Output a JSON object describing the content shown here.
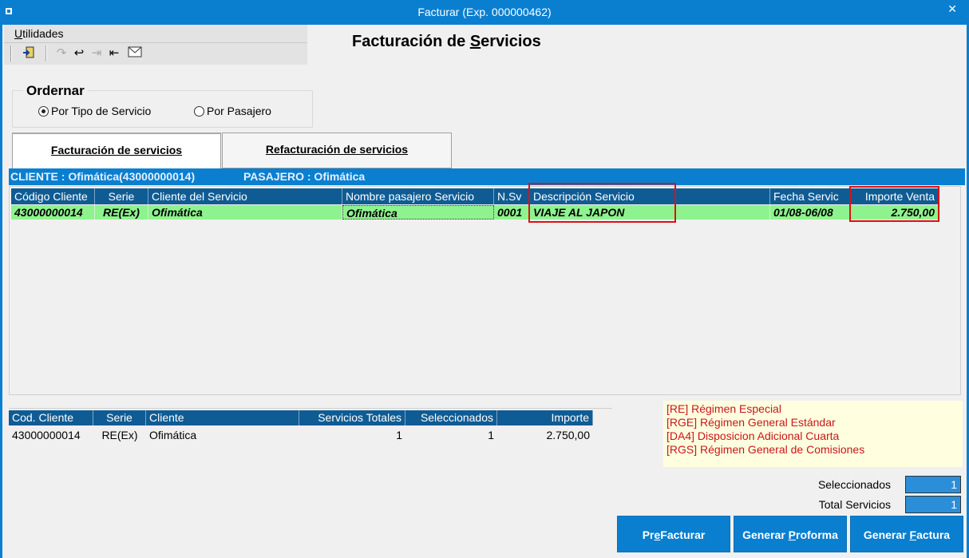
{
  "window": {
    "title": "Facturar (Exp. 000000462)",
    "close_glyph": "✕"
  },
  "menu": {
    "utilidades_underlined": "U",
    "utilidades_rest": "tilidades"
  },
  "toolbar_icons": [
    "exit-icon",
    "redo-icon",
    "undo-icon",
    "forward-icon",
    "back-icon",
    "mail-icon"
  ],
  "heading": {
    "before": "Facturación de ",
    "underlined": "S",
    "after": "ervicios"
  },
  "ordenar": {
    "legend": "Ordernar",
    "option1": "Por Tipo de Servicio",
    "option2": "Por Pasajero",
    "selected": "Por Tipo de Servicio"
  },
  "tabs": {
    "tab1": "Facturación de servicios",
    "tab2": "Refacturación de servicios"
  },
  "infobar": {
    "cliente": "CLIENTE :  Ofimática(43000000014)",
    "pasajero": "PASAJERO : Ofimática"
  },
  "grid": {
    "headers": {
      "codigo": "Código Cliente",
      "serie": "Serie",
      "cliente": "Cliente del Servicio",
      "pasajero": "Nombre pasajero Servicio",
      "nsv": "N.Sv",
      "descripcion": "Descripción Servicio",
      "fecha": "Fecha Servic",
      "importe": "Importe Venta"
    },
    "row": {
      "codigo": "43000000014",
      "serie": "RE(Ex)",
      "cliente": "Ofimática",
      "pasajero": "Ofimática",
      "nsv": "0001",
      "descripcion": "VIAJE AL JAPON",
      "fecha": "01/08-06/08",
      "importe": "2.750,00"
    }
  },
  "summary": {
    "headers": {
      "cod": "Cod. Cliente",
      "serie": "Serie",
      "cliente": "Cliente",
      "totales": "Servicios Totales",
      "seleccionados": "Seleccionados",
      "importe": "Importe"
    },
    "row": {
      "cod": "43000000014",
      "serie": "RE(Ex)",
      "cliente": "Ofimática",
      "totales": "1",
      "seleccionados": "1",
      "importe": "2.750,00"
    }
  },
  "regimes": [
    "[RE] Régimen Especial",
    "[RGE] Régimen General Estándar",
    "[DA4] Disposicion Adicional Cuarta",
    "[RGS] Régimen General de Comisiones"
  ],
  "stats": {
    "seleccionados_label": "Seleccionados",
    "seleccionados_value": "1",
    "total_label": "Total Servicios",
    "total_value": "1"
  },
  "buttons": {
    "prefacturar": {
      "pre": "Pr",
      "ul": "e",
      "post": "Facturar"
    },
    "proforma": {
      "pre": "Generar ",
      "ul": "P",
      "post": "roforma"
    },
    "factura": {
      "pre": "Generar ",
      "ul": "F",
      "post": "actura"
    }
  },
  "colors": {
    "accent": "#0a7fd0",
    "grid_header": "#0f5c94",
    "row_highlight": "#8ef38e",
    "annotation_red": "#e01010",
    "regime_text": "#c81616",
    "legend_bg": "#ffffe0"
  }
}
